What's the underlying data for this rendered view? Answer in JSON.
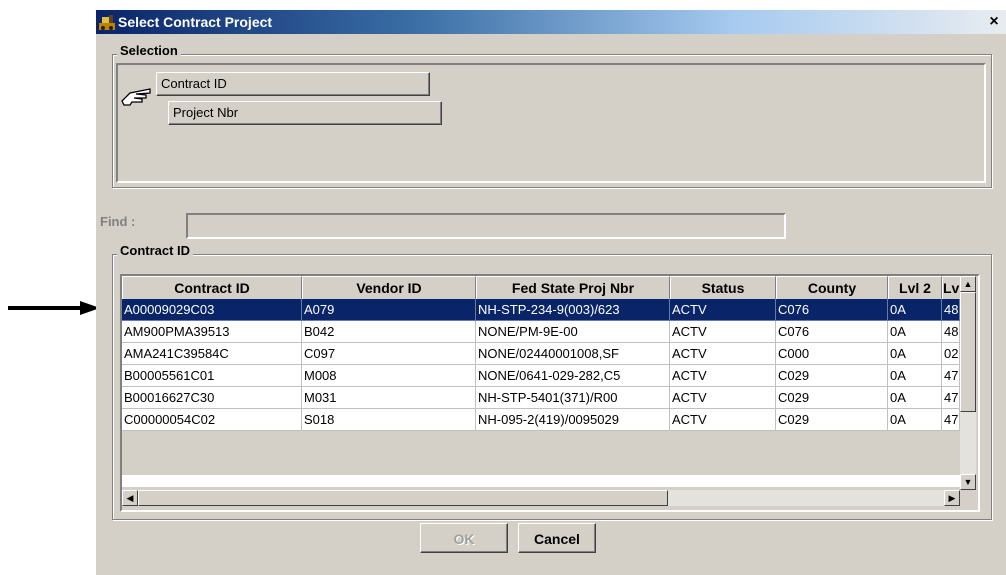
{
  "window": {
    "title": "Select Contract Project",
    "close_glyph": "×"
  },
  "selection": {
    "group_label": "Selection",
    "sort_buttons": [
      "Contract ID",
      "Project Nbr"
    ],
    "pointer_icon": "pointing-hand-icon"
  },
  "find": {
    "label": "Find :",
    "value": ""
  },
  "grid": {
    "group_label": "Contract ID",
    "columns": [
      "Contract ID",
      "Vendor ID",
      "Fed State Proj Nbr",
      "Status",
      "County",
      "Lvl 2",
      "Lv"
    ],
    "rows": [
      [
        "A00009029C03",
        "A079",
        "NH-STP-234-9(003)/623",
        "ACTV",
        "C076",
        "0A",
        "48"
      ],
      [
        "AM900PMA39513",
        "B042",
        "NONE/PM-9E-00",
        "ACTV",
        "C076",
        "0A",
        "48"
      ],
      [
        "AMA241C39584C",
        "C097",
        "NONE/02440001008,SF",
        "ACTV",
        "C000",
        "0A",
        "02"
      ],
      [
        "B00005561C01",
        "M008",
        "NONE/0641-029-282,C5",
        "ACTV",
        "C029",
        "0A",
        "47"
      ],
      [
        "B00016627C30",
        "M031",
        "NH-STP-5401(371)/R00",
        "ACTV",
        "C029",
        "0A",
        "47"
      ],
      [
        "C00000054C02",
        "S018",
        "NH-095-2(419)/0095029",
        "ACTV",
        "C029",
        "0A",
        "47"
      ]
    ],
    "selected_row": 0
  },
  "buttons": {
    "ok": "OK",
    "cancel": "Cancel"
  },
  "colors": {
    "title_start": "#0a246a",
    "selection": "#0a246a",
    "face": "#d4d0c8"
  }
}
